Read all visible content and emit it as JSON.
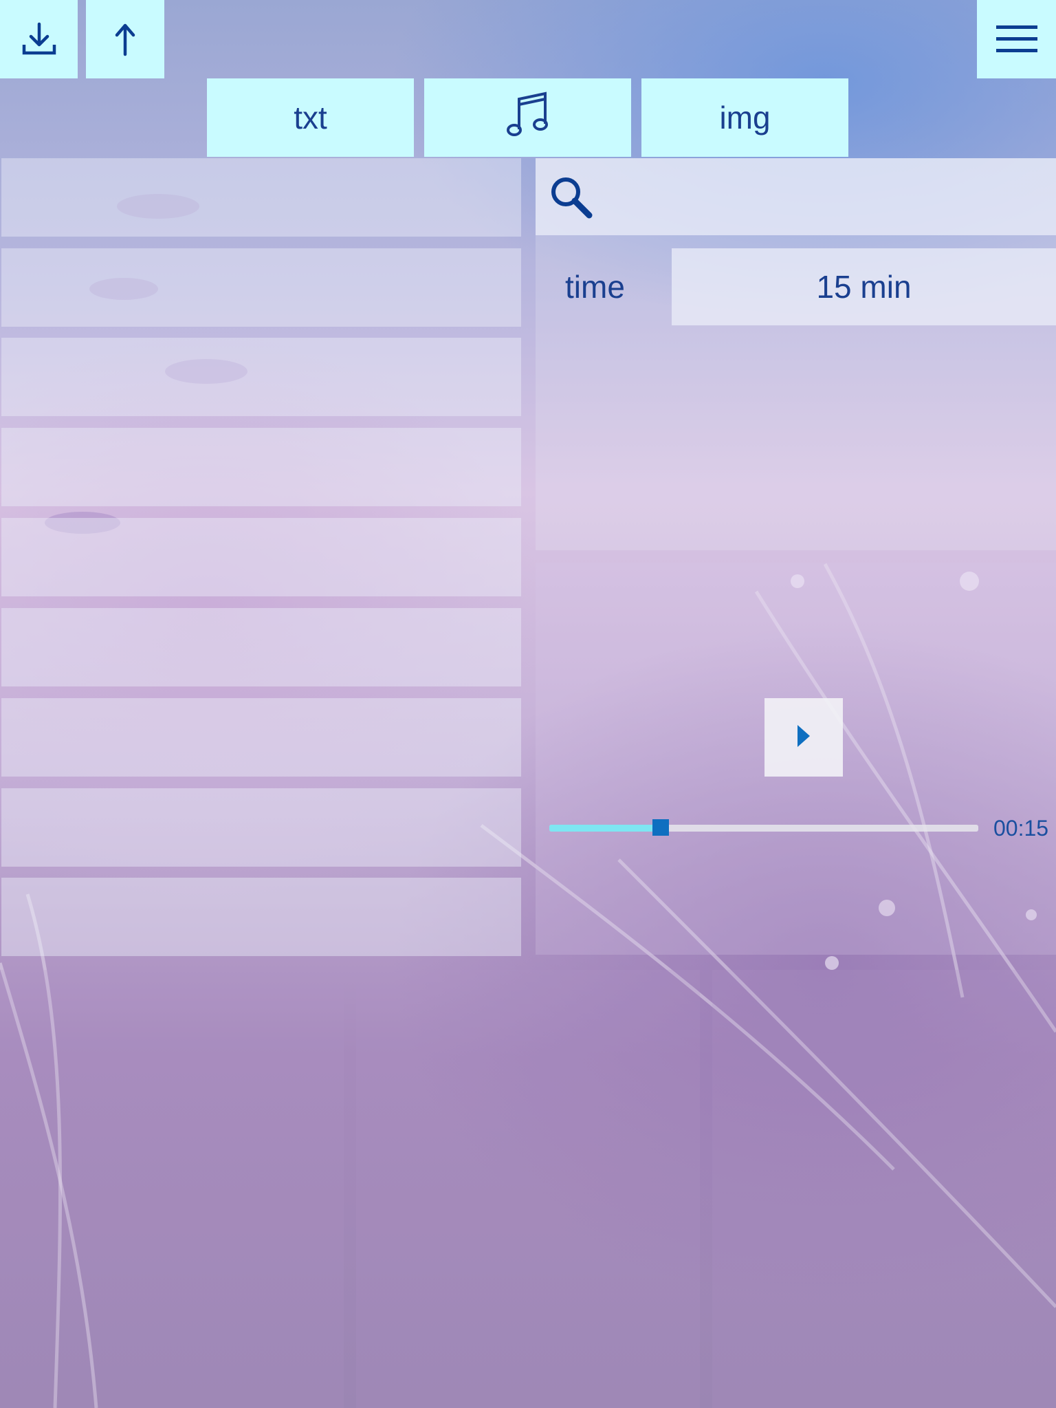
{
  "toolbar": {
    "download_icon": "download-icon",
    "upload_icon": "upload-arrow-icon",
    "menu_icon": "hamburger-menu-icon"
  },
  "tabs": [
    {
      "label": "txt"
    },
    {
      "icon": "music-note-icon"
    },
    {
      "label": "img"
    }
  ],
  "search": {
    "icon": "search-icon"
  },
  "settings": {
    "time_label": "time",
    "time_value": "15 min"
  },
  "player": {
    "play_icon": "play-icon",
    "progress": 0.26,
    "elapsed": "00:15"
  },
  "colors": {
    "button_bg": "#c9fbff",
    "accent_text": "#1a3f8f",
    "progress_fill": "#7ee6f2",
    "progress_thumb": "#0f6fc0"
  }
}
